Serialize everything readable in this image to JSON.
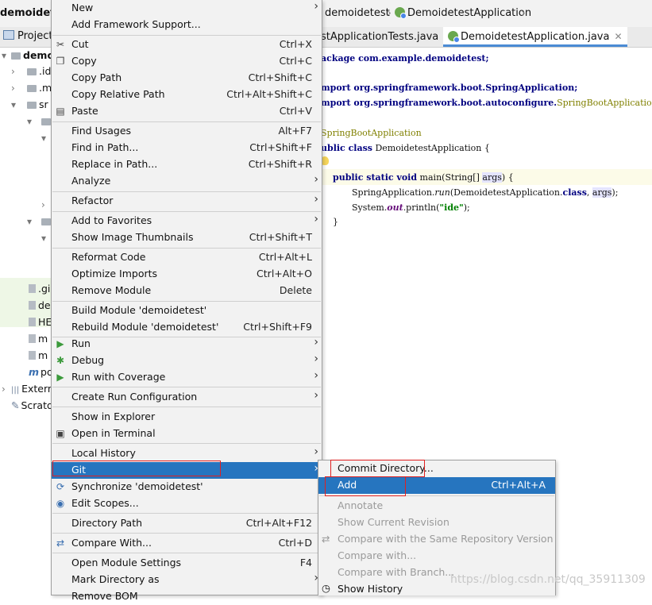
{
  "nav": {
    "project_title": "demoidete",
    "crumb_module": "demoidetest",
    "crumb_class": "DemoidetestApplication"
  },
  "tabs": {
    "project_tab": "Project",
    "file_tab_1": "stApplicationTests.java",
    "file_tab_2": "DemoidetestApplication.java"
  },
  "tree": [
    {
      "label": "demo",
      "arrow": "▾"
    },
    {
      "label": ".id",
      "arrow": "›"
    },
    {
      "label": ".m",
      "arrow": "›"
    },
    {
      "label": "sr",
      "arrow": "▾"
    },
    {
      "label": "",
      "arrow": "▾"
    },
    {
      "label": "",
      "arrow": "▾"
    },
    {
      "label": "",
      "arrow": ""
    },
    {
      "label": "",
      "arrow": ""
    },
    {
      "label": "",
      "arrow": ""
    },
    {
      "label": "",
      "arrow": "›"
    },
    {
      "label": "",
      "arrow": "▾"
    },
    {
      "label": "",
      "arrow": "▾"
    },
    {
      "label": ".gi",
      "arrow": ""
    },
    {
      "label": "de",
      "arrow": ""
    },
    {
      "label": "HE",
      "arrow": ""
    },
    {
      "label": "m",
      "arrow": ""
    },
    {
      "label": "m",
      "arrow": ""
    },
    {
      "label": "po",
      "arrow": ""
    },
    {
      "label": "Extern",
      "arrow": "›"
    },
    {
      "label": "Scrato",
      "arrow": ""
    }
  ],
  "code": {
    "l1": "ackage com.example.demoidetest;",
    "l2a": "mport org.springframework.boot.SpringApplication;",
    "l3a": "mport org.springframework.boot.autoconfigure.",
    "l3b": "SpringBootApplication;",
    "l4": "SpringBootApplication",
    "l5a": "ublic class",
    "l5b": " DemoidetestApplication {",
    "l6a": "public static void",
    "l6b": " main(String[] ",
    "l6c": "args",
    "l6d": ") {",
    "l7a": "SpringApplication.",
    "l7b": "run",
    "l7c": "(DemoidetestApplication.",
    "l7d": "class",
    "l7e": ", ",
    "l7f": "args",
    "l7g": ");",
    "l8a": "System.",
    "l8b": "out",
    "l8c": ".println(",
    "l8d": "\"ide\"",
    "l8e": ");",
    "l9": "}"
  },
  "menu": {
    "new": "New",
    "add_framework": "Add Framework Support...",
    "cut": "Cut",
    "cut_sc": "Ctrl+X",
    "copy": "Copy",
    "copy_sc": "Ctrl+C",
    "copy_path": "Copy Path",
    "copy_path_sc": "Ctrl+Shift+C",
    "copy_rel": "Copy Relative Path",
    "copy_rel_sc": "Ctrl+Alt+Shift+C",
    "paste": "Paste",
    "paste_sc": "Ctrl+V",
    "find_usages": "Find Usages",
    "find_usages_sc": "Alt+F7",
    "find_in_path": "Find in Path...",
    "find_in_path_sc": "Ctrl+Shift+F",
    "replace_in_path": "Replace in Path...",
    "replace_in_path_sc": "Ctrl+Shift+R",
    "analyze": "Analyze",
    "refactor": "Refactor",
    "add_favorites": "Add to Favorites",
    "thumbnails": "Show Image Thumbnails",
    "thumbnails_sc": "Ctrl+Shift+T",
    "reformat": "Reformat Code",
    "reformat_sc": "Ctrl+Alt+L",
    "optimize": "Optimize Imports",
    "optimize_sc": "Ctrl+Alt+O",
    "remove_module": "Remove Module",
    "remove_module_sc": "Delete",
    "build_module": "Build Module 'demoidetest'",
    "rebuild_module": "Rebuild Module 'demoidetest'",
    "rebuild_module_sc": "Ctrl+Shift+F9",
    "run": "Run",
    "debug": "Debug",
    "run_coverage": "Run with Coverage",
    "create_run": "Create Run Configuration",
    "show_explorer": "Show in Explorer",
    "open_terminal": "Open in Terminal",
    "local_history": "Local History",
    "git": "Git",
    "synchronize": "Synchronize 'demoidetest'",
    "edit_scopes": "Edit Scopes...",
    "directory_path": "Directory Path",
    "directory_path_sc": "Ctrl+Alt+F12",
    "compare_with": "Compare With...",
    "compare_with_sc": "Ctrl+D",
    "module_settings": "Open Module Settings",
    "module_settings_sc": "F4",
    "mark_directory": "Mark Directory as",
    "remove_bom": "Remove BOM"
  },
  "git_menu": {
    "commit_dir": "Commit Directory...",
    "add": "Add",
    "add_sc": "Ctrl+Alt+A",
    "annotate": "Annotate",
    "show_current": "Show Current Revision",
    "compare_same": "Compare with the Same Repository Version",
    "compare_with": "Compare with...",
    "compare_branch": "Compare with Branch...",
    "show_history": "Show History"
  },
  "watermark": "https://blog.csdn.net/qq_35911309",
  "colors": {
    "selection": "#2675bf",
    "highlight_box": "#e02020",
    "menu_bg": "#f2f2f2"
  }
}
